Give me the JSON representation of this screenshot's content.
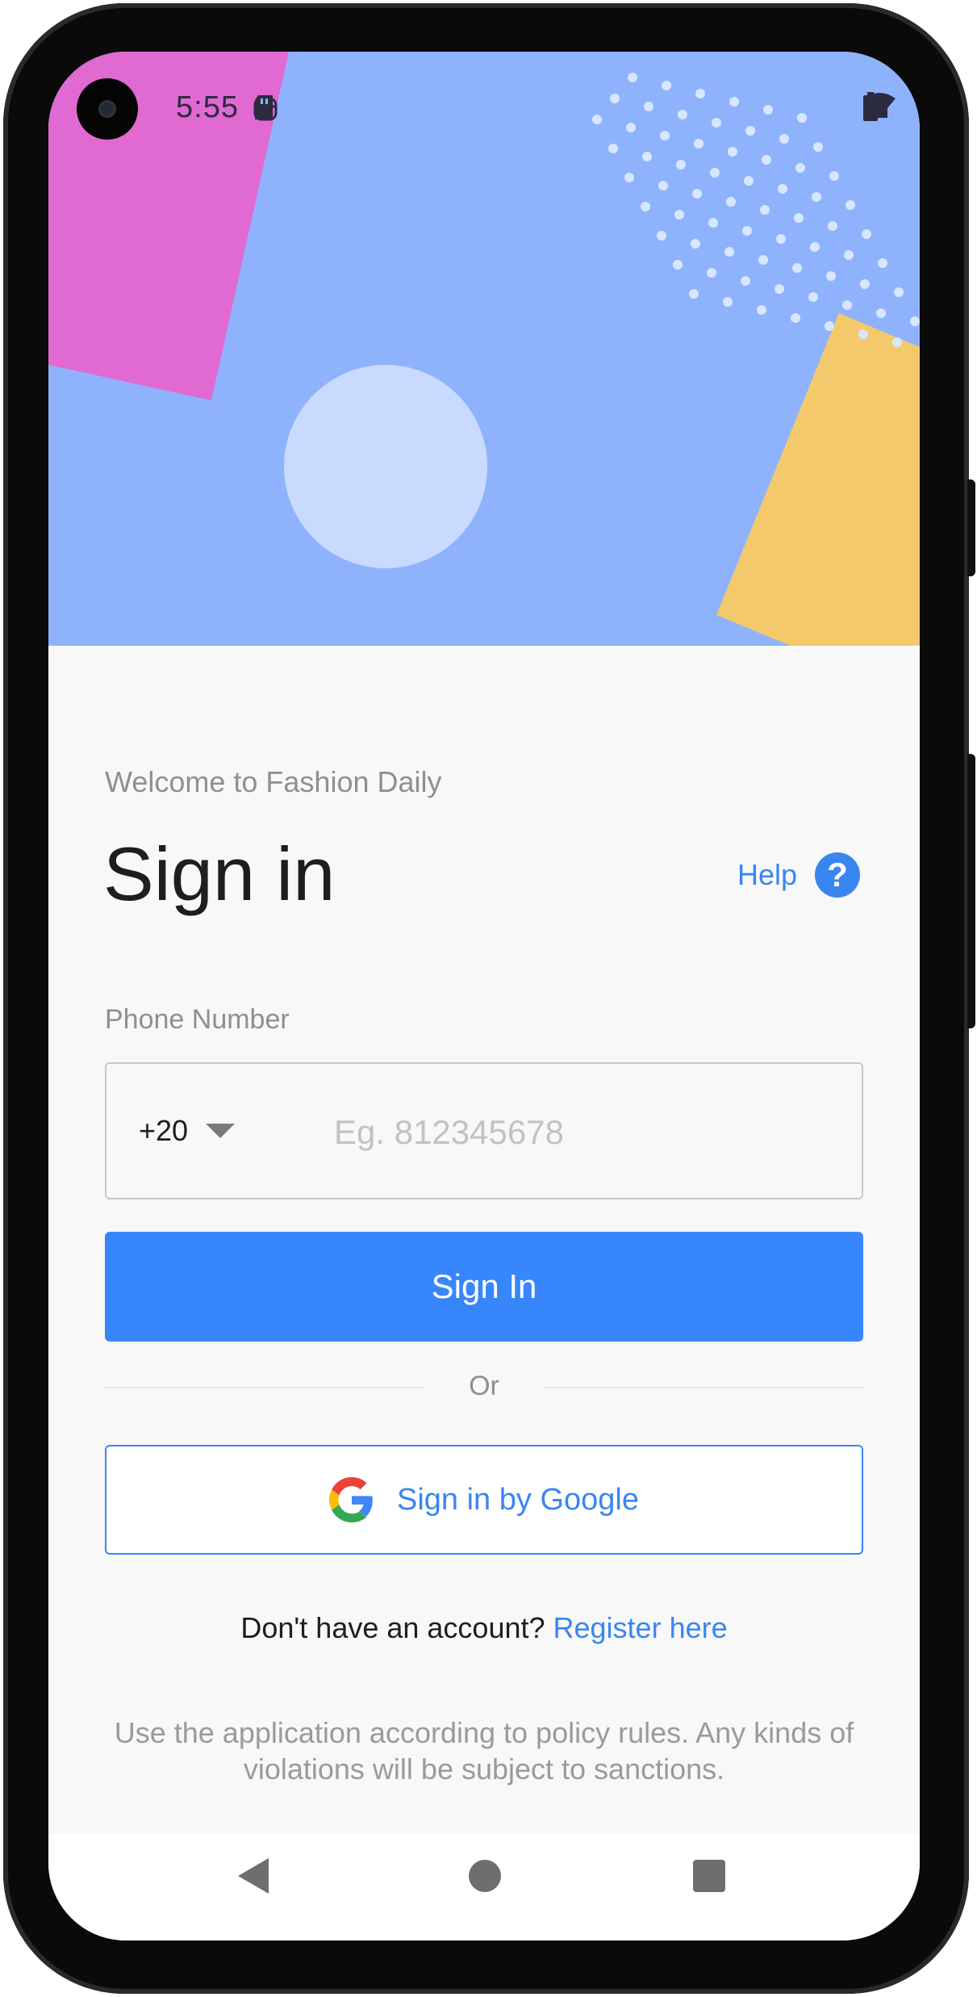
{
  "status_bar": {
    "time": "5:55"
  },
  "header": {
    "welcome": "Welcome to Fashion Daily",
    "title": "Sign in",
    "help_label": "Help",
    "help_icon_glyph": "?"
  },
  "form": {
    "phone_label": "Phone Number",
    "country_code": "+20",
    "phone_placeholder": "Eg. 812345678",
    "phone_value": "",
    "sign_in_button": "Sign In",
    "divider_text": "Or",
    "google_button": "Sign in by Google"
  },
  "footer": {
    "register_question": "Don't have an account?",
    "register_link": "Register here",
    "policy_text": "Use the application according to policy rules. Any kinds of violations will be subject to sanctions."
  },
  "colors": {
    "accent": "#3886fb",
    "hero_bg": "#8eb3fc",
    "hero_pink": "#e06ad2",
    "hero_yellow": "#f4c96c",
    "hero_circle": "#c8dafe"
  },
  "icons": {
    "status_left": [
      "face-icon",
      "sd-card-icon"
    ],
    "status_right": [
      "wifi-icon",
      "signal-icon",
      "battery-icon"
    ],
    "google": "google-logo-icon",
    "help": "help-circle-icon",
    "navigation": [
      "back-icon",
      "home-icon",
      "recents-icon"
    ]
  }
}
